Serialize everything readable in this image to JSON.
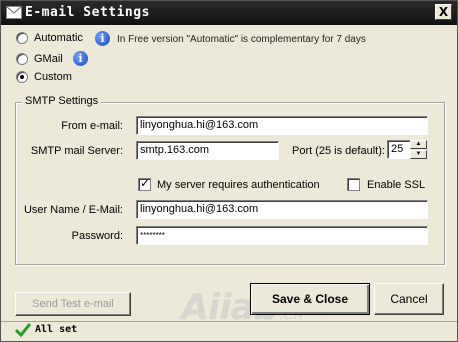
{
  "window": {
    "title": "E-mail Settings",
    "close_glyph": "X"
  },
  "mode": {
    "options": [
      {
        "label": "Automatic",
        "checked": false
      },
      {
        "label": "GMail",
        "checked": false
      },
      {
        "label": "Custom",
        "checked": true
      }
    ],
    "automatic_note": "In Free version \"Automatic\" is complementary for 7 days"
  },
  "smtp": {
    "group_title": "SMTP Settings",
    "from_label": "From e-mail:",
    "from_value": "linyonghua.hi@163.com",
    "server_label": "SMTP mail Server:",
    "server_value": "smtp.163.com",
    "port_label": "Port (25 is default):",
    "port_value": "25",
    "auth_label": "My server requires authentication",
    "auth_checked": true,
    "ssl_label": "Enable SSL",
    "ssl_checked": false,
    "user_label": "User Name / E-Mail:",
    "user_value": "linyonghua.hi@163.com",
    "password_label": "Password:",
    "password_value": "********"
  },
  "buttons": {
    "send_test": "Send Test e-mail",
    "save_close": "Save & Close",
    "cancel": "Cancel"
  },
  "status": {
    "text": "All set",
    "icon": "checkmark-icon",
    "icon_color": "#2a9d2a"
  },
  "watermark": {
    "brand": "Aiiab",
    "domain": ".CN"
  },
  "icons": {
    "info": "info-icon",
    "mail": "envelope-icon"
  },
  "colors": {
    "titlebar": "#111111",
    "dialog": "#ece9d8",
    "info": "#1646b8"
  }
}
